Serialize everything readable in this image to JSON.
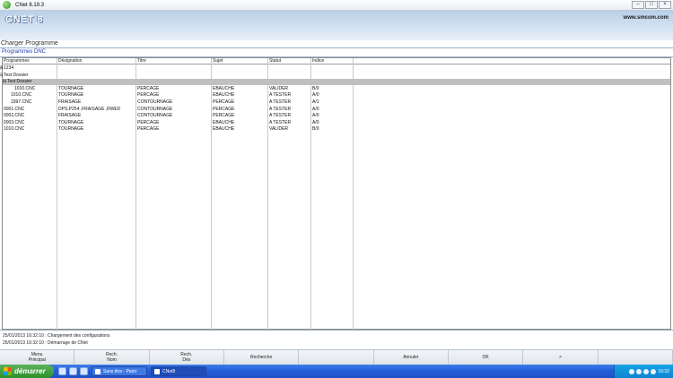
{
  "window": {
    "title": "CNet 8.19.3"
  },
  "banner": {
    "brand": "CNET 8",
    "url": "www.smcom.com"
  },
  "section_title": "Charger Programme",
  "panel": {
    "title": "Programmes DNC"
  },
  "columns": [
    "Programmes",
    "Désignation",
    "Titre",
    "Sujet",
    "Statut",
    "Indice"
  ],
  "rows": [
    {
      "indent": "⊞ ",
      "depth": 1,
      "name": "1234",
      "designation": "",
      "titre": "",
      "sujet": "",
      "statut": "",
      "indice": "",
      "selected": false
    },
    {
      "indent": "⊟ ",
      "depth": 1,
      "name": "Test Dossier",
      "designation": "",
      "titre": "",
      "sujet": "",
      "statut": "",
      "indice": "",
      "selected": false
    },
    {
      "indent": "⊟ ",
      "depth": 2,
      "name": "Test Dossier",
      "designation": "",
      "titre": "",
      "sujet": "",
      "statut": "",
      "indice": "",
      "selected": true
    },
    {
      "indent": "",
      "depth": 4,
      "name": "1010.CNC",
      "designation": "TOURNAGE",
      "titre": "PERCAGE",
      "sujet": "EBAUCHE",
      "statut": "VALIDER",
      "indice": "B/0",
      "selected": false
    },
    {
      "indent": "",
      "depth": 3,
      "name": "1010.CNC",
      "designation": "TOURNAGE",
      "titre": "PERCAGE",
      "sujet": "EBAUCHE",
      "statut": "A TESTER",
      "indice": "A/0",
      "selected": false
    },
    {
      "indent": "",
      "depth": 3,
      "name": "1997.CNC",
      "designation": "FRAISAGE",
      "titre": "CONTOURNAGE",
      "sujet": "PERCAGE",
      "statut": "A TESTER",
      "indice": "A/1",
      "selected": false
    },
    {
      "indent": "",
      "depth": 1,
      "name": "0001.CNC",
      "designation": "DPS,P254 ,FRAISAGE ,RWED",
      "titre": "CONTOURNAGE",
      "sujet": "PERCAGE",
      "statut": "A TESTER",
      "indice": "A/0",
      "selected": false
    },
    {
      "indent": "",
      "depth": 1,
      "name": "0002.CNC",
      "designation": "FRAISAGE",
      "titre": "CONTOURNAGE",
      "sujet": "PERCAGE",
      "statut": "A TESTER",
      "indice": "A/0",
      "selected": false
    },
    {
      "indent": "",
      "depth": 1,
      "name": "0003.CNC",
      "designation": "TOURNAGE",
      "titre": "PERCAGE",
      "sujet": "EBAUCHE",
      "statut": "A TESTER",
      "indice": "A/0",
      "selected": false
    },
    {
      "indent": "",
      "depth": 1,
      "name": "1010.CNC",
      "designation": "TOURNAGE",
      "titre": "PERCAGE",
      "sujet": "EBAUCHE",
      "statut": "VALIDER",
      "indice": "B/0",
      "selected": false
    }
  ],
  "log": [
    "25/01/2013 16:32:10 : Chargement des configurations",
    "25/01/2013 16:32:10 : Démarrage de CNet"
  ],
  "actions": [
    {
      "id": "menu-principal",
      "label": "Menu\nPrincipal"
    },
    {
      "id": "rech-nom",
      "label": "Rech.\nNom"
    },
    {
      "id": "rech-des",
      "label": "Rech.\nDés"
    },
    {
      "id": "recherche",
      "label": "Recherche"
    },
    {
      "id": "blank",
      "label": ""
    },
    {
      "id": "annuler",
      "label": "Annuler"
    },
    {
      "id": "ok",
      "label": "OK"
    },
    {
      "id": "next",
      "label": ">"
    },
    {
      "id": "blank2",
      "label": ""
    }
  ],
  "taskbar": {
    "start": "démarrer",
    "tasks": [
      {
        "label": "Sans titre - Paint",
        "active": false
      },
      {
        "label": "CNet8",
        "active": true
      }
    ],
    "clock": "16:32"
  },
  "colors": {
    "selected_row": "#c0c0c0",
    "panel_title": "#1a3aa8",
    "taskbar": "#245edb",
    "start": "#2f8f2b"
  },
  "icons": {
    "app": "cnet-app-icon",
    "start": "windows-flag-icon"
  }
}
